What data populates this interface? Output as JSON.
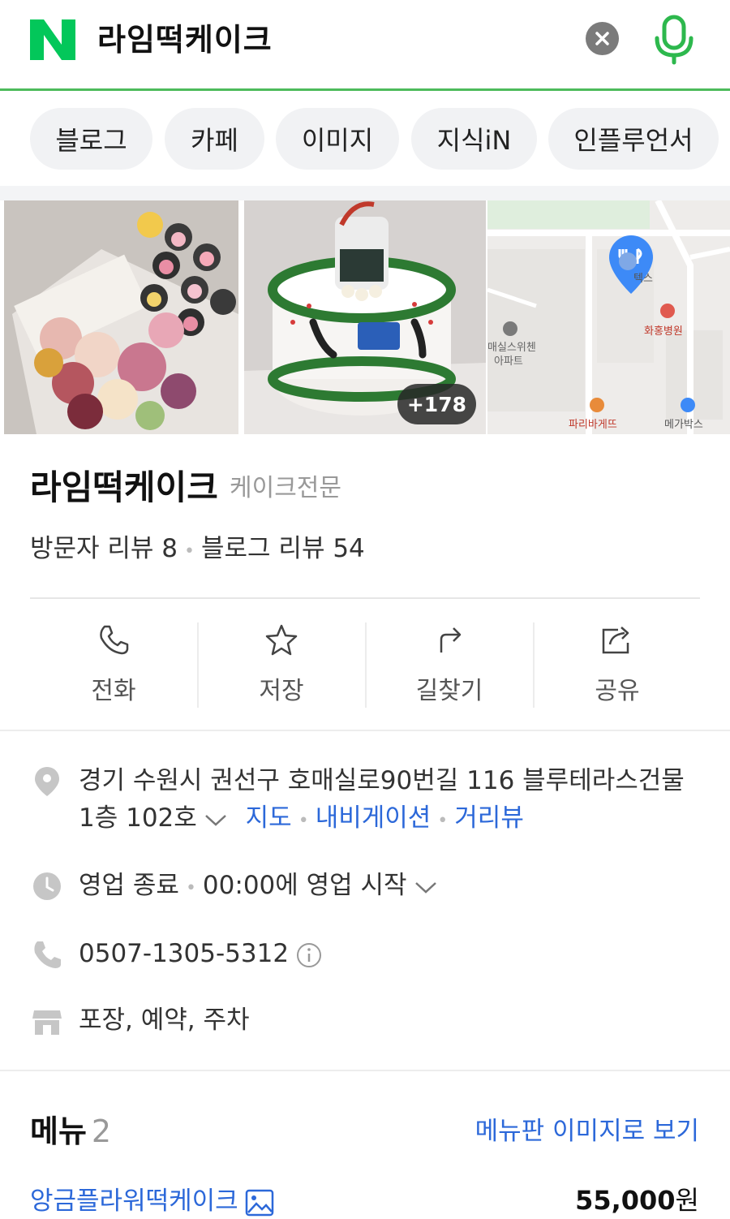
{
  "search": {
    "logo": "N",
    "query": "라임떡케이크",
    "colors": {
      "brand": "#03c75a",
      "accent_line": "#4dbb5b"
    }
  },
  "tabs": [
    "블로그",
    "카페",
    "이미지",
    "지식iN",
    "인플루언서"
  ],
  "photos": {
    "more_count": "+178",
    "map_labels": [
      "텍스",
      "화홍병원",
      "매실스위첸",
      "아파트",
      "파리바게뜨",
      "메가박스"
    ]
  },
  "place": {
    "name": "라임떡케이크",
    "category": "케이크전문",
    "visitor_reviews": "방문자 리뷰 8",
    "blog_reviews": "블로그 리뷰 54"
  },
  "actions": [
    "전화",
    "저장",
    "길찾기",
    "공유"
  ],
  "info": {
    "address_line1": "경기 수원시 권선구 호매실로90번길 116 블루테라스건물",
    "address_line2": "1층 102호",
    "address_links": [
      "지도",
      "내비게이션",
      "거리뷰"
    ],
    "hours_status": "영업 종료",
    "hours_next": "00:00에 영업 시작",
    "phone": "0507-1305-5312",
    "services": "포장, 예약, 주차"
  },
  "menu": {
    "title": "메뉴",
    "count": "2",
    "view_link": "메뉴판 이미지로 보기",
    "items": [
      {
        "name": "앙금플라워떡케이크",
        "price": "55,000",
        "unit": "원"
      }
    ]
  }
}
